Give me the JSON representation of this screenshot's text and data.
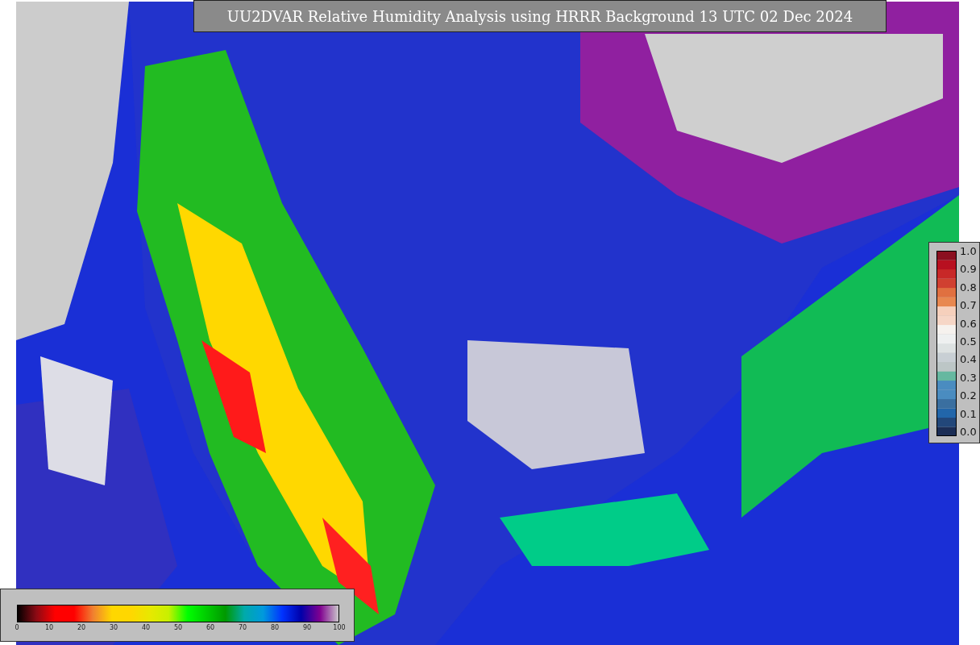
{
  "title": "UU2DVAR Relative Humidity Analysis using HRRR Background 13 UTC 02 Dec 2024",
  "humidity_colorbar": {
    "ticks": [
      "0",
      "10",
      "20",
      "30",
      "40",
      "50",
      "60",
      "70",
      "80",
      "90",
      "100"
    ]
  },
  "station_colorbar": {
    "ticks": [
      "1.0",
      "0.9",
      "0.8",
      "0.7",
      "0.6",
      "0.5",
      "0.4",
      "0.3",
      "0.2",
      "0.1",
      "0.0"
    ]
  }
}
